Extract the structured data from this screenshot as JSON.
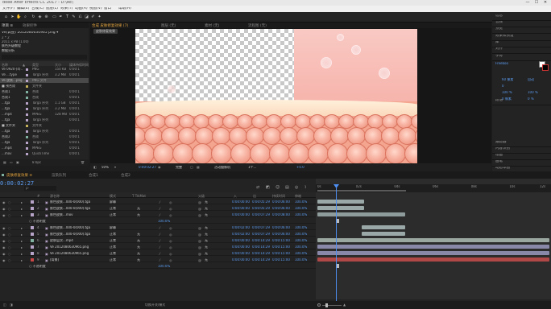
{
  "titlebar": {
    "title": "dobe After Effects CC 2017 - D:\\AE\\",
    "minimize": "—",
    "maximize": "☐",
    "close": "✕"
  },
  "menu": {
    "items": [
      "文件(F)",
      "编辑(E)",
      "合成(C)",
      "图层(L)",
      "效果(T)",
      "动画(A)",
      "视图(V)",
      "窗口",
      "帮助(H)"
    ]
  },
  "project": {
    "tabs": [
      "项目 ≡",
      "效果控件"
    ],
    "file_name": "Ve(调整) 2012080630965 png ▾",
    "file_info": "2 * 2",
    "file_info2": "2011 x PB (1.00)",
    "desc1": "肤色升级教程",
    "desc2": "数据分析",
    "columns": [
      "名称",
      "▲",
      "类型",
      "大小",
      "媒体持续时间"
    ],
    "rows": [
      {
        "name": "Ve 0920-(4)...png",
        "type": "PNG",
        "size": "150 KB",
        "dur": "0:00:1",
        "color": "#b8a4c8",
        "selected": false
      },
      {
        "name": "Ve ...type",
        "type": "Targa 序列",
        "size": "3.2 MB",
        "dur": "0:00:1",
        "color": "#b8a4c8",
        "selected": false
      },
      {
        "name": "Ve 皮肤...png",
        "type": "PNG 文件",
        "size": "",
        "dur": "",
        "color": "#b8a4c8",
        "selected": true
      },
      {
        "name": "■ 预合成",
        "type": "文件夹",
        "size": "",
        "dur": "",
        "color": "#c5b05a",
        "selected": false
      },
      {
        "name": "合成1",
        "type": "合成",
        "size": "",
        "dur": "0:00:1",
        "color": "#7fb0a0",
        "selected": false
      },
      {
        "name": "合成1",
        "type": "合成",
        "size": "",
        "dur": "0:00:1",
        "color": "#7fb0a0",
        "selected": false
      },
      {
        "name": "...tga",
        "type": "Targa 序列",
        "size": "1.1 GB",
        "dur": "0:00:1",
        "color": "#b8a4c8",
        "selected": false
      },
      {
        "name": "...tga",
        "type": "Targa 序列",
        "size": "3.2 MB",
        "dur": "0:00:1",
        "color": "#b8a4c8",
        "selected": false
      },
      {
        "name": "...mp4",
        "type": "MPEG",
        "size": "128 MB",
        "dur": "0:00:1",
        "color": "#b8a4c8",
        "selected": false
      },
      {
        "name": "...tga",
        "type": "Targa 序列",
        "size": "",
        "dur": "0:00:1",
        "color": "#b8a4c8",
        "selected": false
      },
      {
        "name": "■ 文件夹",
        "type": "文件夹",
        "size": "",
        "dur": "",
        "color": "#c5b05a",
        "selected": false
      },
      {
        "name": "...tga",
        "type": "Targa 序列",
        "size": "",
        "dur": "0:00:1",
        "color": "#b8a4c8",
        "selected": false
      },
      {
        "name": "合成2",
        "type": "合成",
        "size": "",
        "dur": "0:00:1",
        "color": "#7fb0a0",
        "selected": false
      },
      {
        "name": "...tga",
        "type": "Targa 序列",
        "size": "",
        "dur": "0:00:1",
        "color": "#b8a4c8",
        "selected": false
      },
      {
        "name": "...mp4",
        "type": "MPEG",
        "size": "",
        "dur": "0:00:1",
        "color": "#b8a4c8",
        "selected": false
      },
      {
        "name": "...mov",
        "type": "QuickTime",
        "size": "",
        "dur": "0:00:1",
        "color": "#b8a4c8",
        "selected": false
      }
    ],
    "footer": "8 bpc"
  },
  "viewer": {
    "tabs": [
      "合成 皮肤修复效果 (7)",
      "图层 (无)",
      "素材 (无)",
      "流程图 (无)"
    ],
    "comp_tab": "皮肤修复效果",
    "zoom": "50%",
    "timecode": "0:00:02:27",
    "quality": "完整",
    "camera": "活动摄像机",
    "views": "1个...",
    "exposure": "+0.0"
  },
  "right": {
    "sections": [
      "信息",
      "音频",
      "预览",
      "效果和预设",
      "库",
      "对齐",
      "字符",
      "段落",
      "跟踪器",
      "内容识别",
      "绘画",
      "画笔",
      "动态草图"
    ],
    "font": "Freeboo",
    "size_a": "60 像素",
    "size_b": "自动",
    "tracking": "0",
    "scale_a": "100 %",
    "scale_b": "100 %",
    "baseline": "0 像素",
    "tsume": "0 %"
  },
  "timeline": {
    "tabs": [
      "皮肤修复效果 ≡",
      "渲染队列",
      "合成1",
      "合成2"
    ],
    "current_time": "0:00:02:27",
    "search_placeholder": "ρ-",
    "columns": [
      "#",
      "源名称",
      "模式",
      "T TrkMat",
      "父级",
      "入",
      "出",
      "持续时间",
      "伸缩"
    ],
    "ruler_ticks": [
      "0s",
      "02s",
      "04s",
      "06s",
      "08s",
      "10s",
      "12s"
    ],
    "layers": [
      {
        "num": "1",
        "name": "肤色皮肤...000-0(000).tga",
        "mode": "屏幕",
        "trk": "",
        "parent": "无",
        "in": "0:00:00:00",
        "out": "0:00:05:29",
        "dur": "0:00:06:00",
        "stretch": "100.0%",
        "label": "#b8a4c8",
        "bar": [
          0.0,
          0.2
        ],
        "barcolor": "#9aa8a8"
      },
      {
        "num": "2",
        "name": "肤色皮肤...000-0(000).tga",
        "mode": "正常",
        "trk": "无",
        "parent": "无",
        "in": "0:00:00:00",
        "out": "0:00:05:29",
        "dur": "0:00:06:00",
        "stretch": "100.0%",
        "label": "#b8a4c8",
        "bar": [
          0.0,
          0.2
        ],
        "barcolor": "#9aa8a8"
      },
      {
        "num": "3",
        "name": "肤色皮肤...mov",
        "mode": "正常",
        "trk": "无",
        "parent": "无",
        "in": "0:00:00:00",
        "out": "0:00:07:29",
        "dur": "0:00:08:00",
        "stretch": "100.0%",
        "label": "#b8a4c8",
        "bar": [
          0.0,
          0.38
        ],
        "barcolor": "#8e9c9c"
      },
      {
        "num": "",
        "name": "",
        "mode": "",
        "trk": "",
        "parent": "",
        "in": "",
        "out": "",
        "dur": "",
        "stretch": "",
        "label": "",
        "bar": null,
        "barcolor": "",
        "sub": "○ 不透明度",
        "subval": "100.0%"
      },
      {
        "num": "4",
        "name": "肤色皮肤...000-0(000).tga",
        "mode": "屏幕",
        "trk": "",
        "parent": "无",
        "in": "0:00:02:00",
        "out": "0:00:07:29",
        "dur": "0:00:06:00",
        "stretch": "100.0%",
        "label": "#b8a4c8",
        "bar": [
          0.19,
          0.38
        ],
        "barcolor": "#9aa8a8"
      },
      {
        "num": "5",
        "name": "肤色皮肤...000-0(000).tga",
        "mode": "正常",
        "trk": "无",
        "parent": "无",
        "in": "0:00:02:00",
        "out": "0:00:07:29",
        "dur": "0:00:06:00",
        "stretch": "100.0%",
        "label": "#b8a4c8",
        "bar": [
          0.19,
          0.38
        ],
        "barcolor": "#9aa8a8"
      },
      {
        "num": "6",
        "name": "皮肤层次...mp4",
        "mode": "正常",
        "trk": "无",
        "parent": "无",
        "in": "0:00:00:00",
        "out": "0:00:14:29",
        "dur": "0:00:15:00",
        "stretch": "100.0%",
        "label": "#7fb0a0",
        "bar": [
          0.0,
          1.0
        ],
        "barcolor": "#9aa6a0"
      },
      {
        "num": "7",
        "name": "Ve 2012080630965.png",
        "mode": "正常",
        "trk": "无",
        "parent": "无",
        "in": "0:00:00:00",
        "out": "0:00:14:29",
        "dur": "0:00:15:00",
        "stretch": "100.0%",
        "label": "#b8a4c8",
        "bar": [
          0.0,
          1.0
        ],
        "barcolor": "#8a88a8"
      },
      {
        "num": "8",
        "name": "Ve 2012080630965.png",
        "mode": "正常",
        "trk": "无",
        "parent": "无",
        "in": "0:00:00:00",
        "out": "0:00:14:29",
        "dur": "0:00:15:00",
        "stretch": "100.0%",
        "label": "#b8a4c8",
        "bar": [
          0.0,
          1.0
        ],
        "barcolor": "#8a88a8"
      },
      {
        "num": "9",
        "name": "[背景]",
        "mode": "正常",
        "trk": "无",
        "parent": "无",
        "in": "0:00:00:00",
        "out": "0:00:14:29",
        "dur": "0:00:15:00",
        "stretch": "100.0%",
        "label": "#c84848",
        "bar": [
          0.0,
          1.0
        ],
        "barcolor": "#b04848"
      },
      {
        "num": "",
        "name": "",
        "mode": "",
        "trk": "",
        "parent": "",
        "in": "",
        "out": "",
        "dur": "",
        "stretch": "",
        "label": "",
        "bar": null,
        "barcolor": "",
        "sub": "○ 不透明度",
        "subval": "100.0%"
      }
    ],
    "footer_toggle": "切换开关/模式"
  },
  "colors": {
    "accent": "#5b9cf2",
    "tab_active": "#e2a33c",
    "panel": "#232323"
  }
}
